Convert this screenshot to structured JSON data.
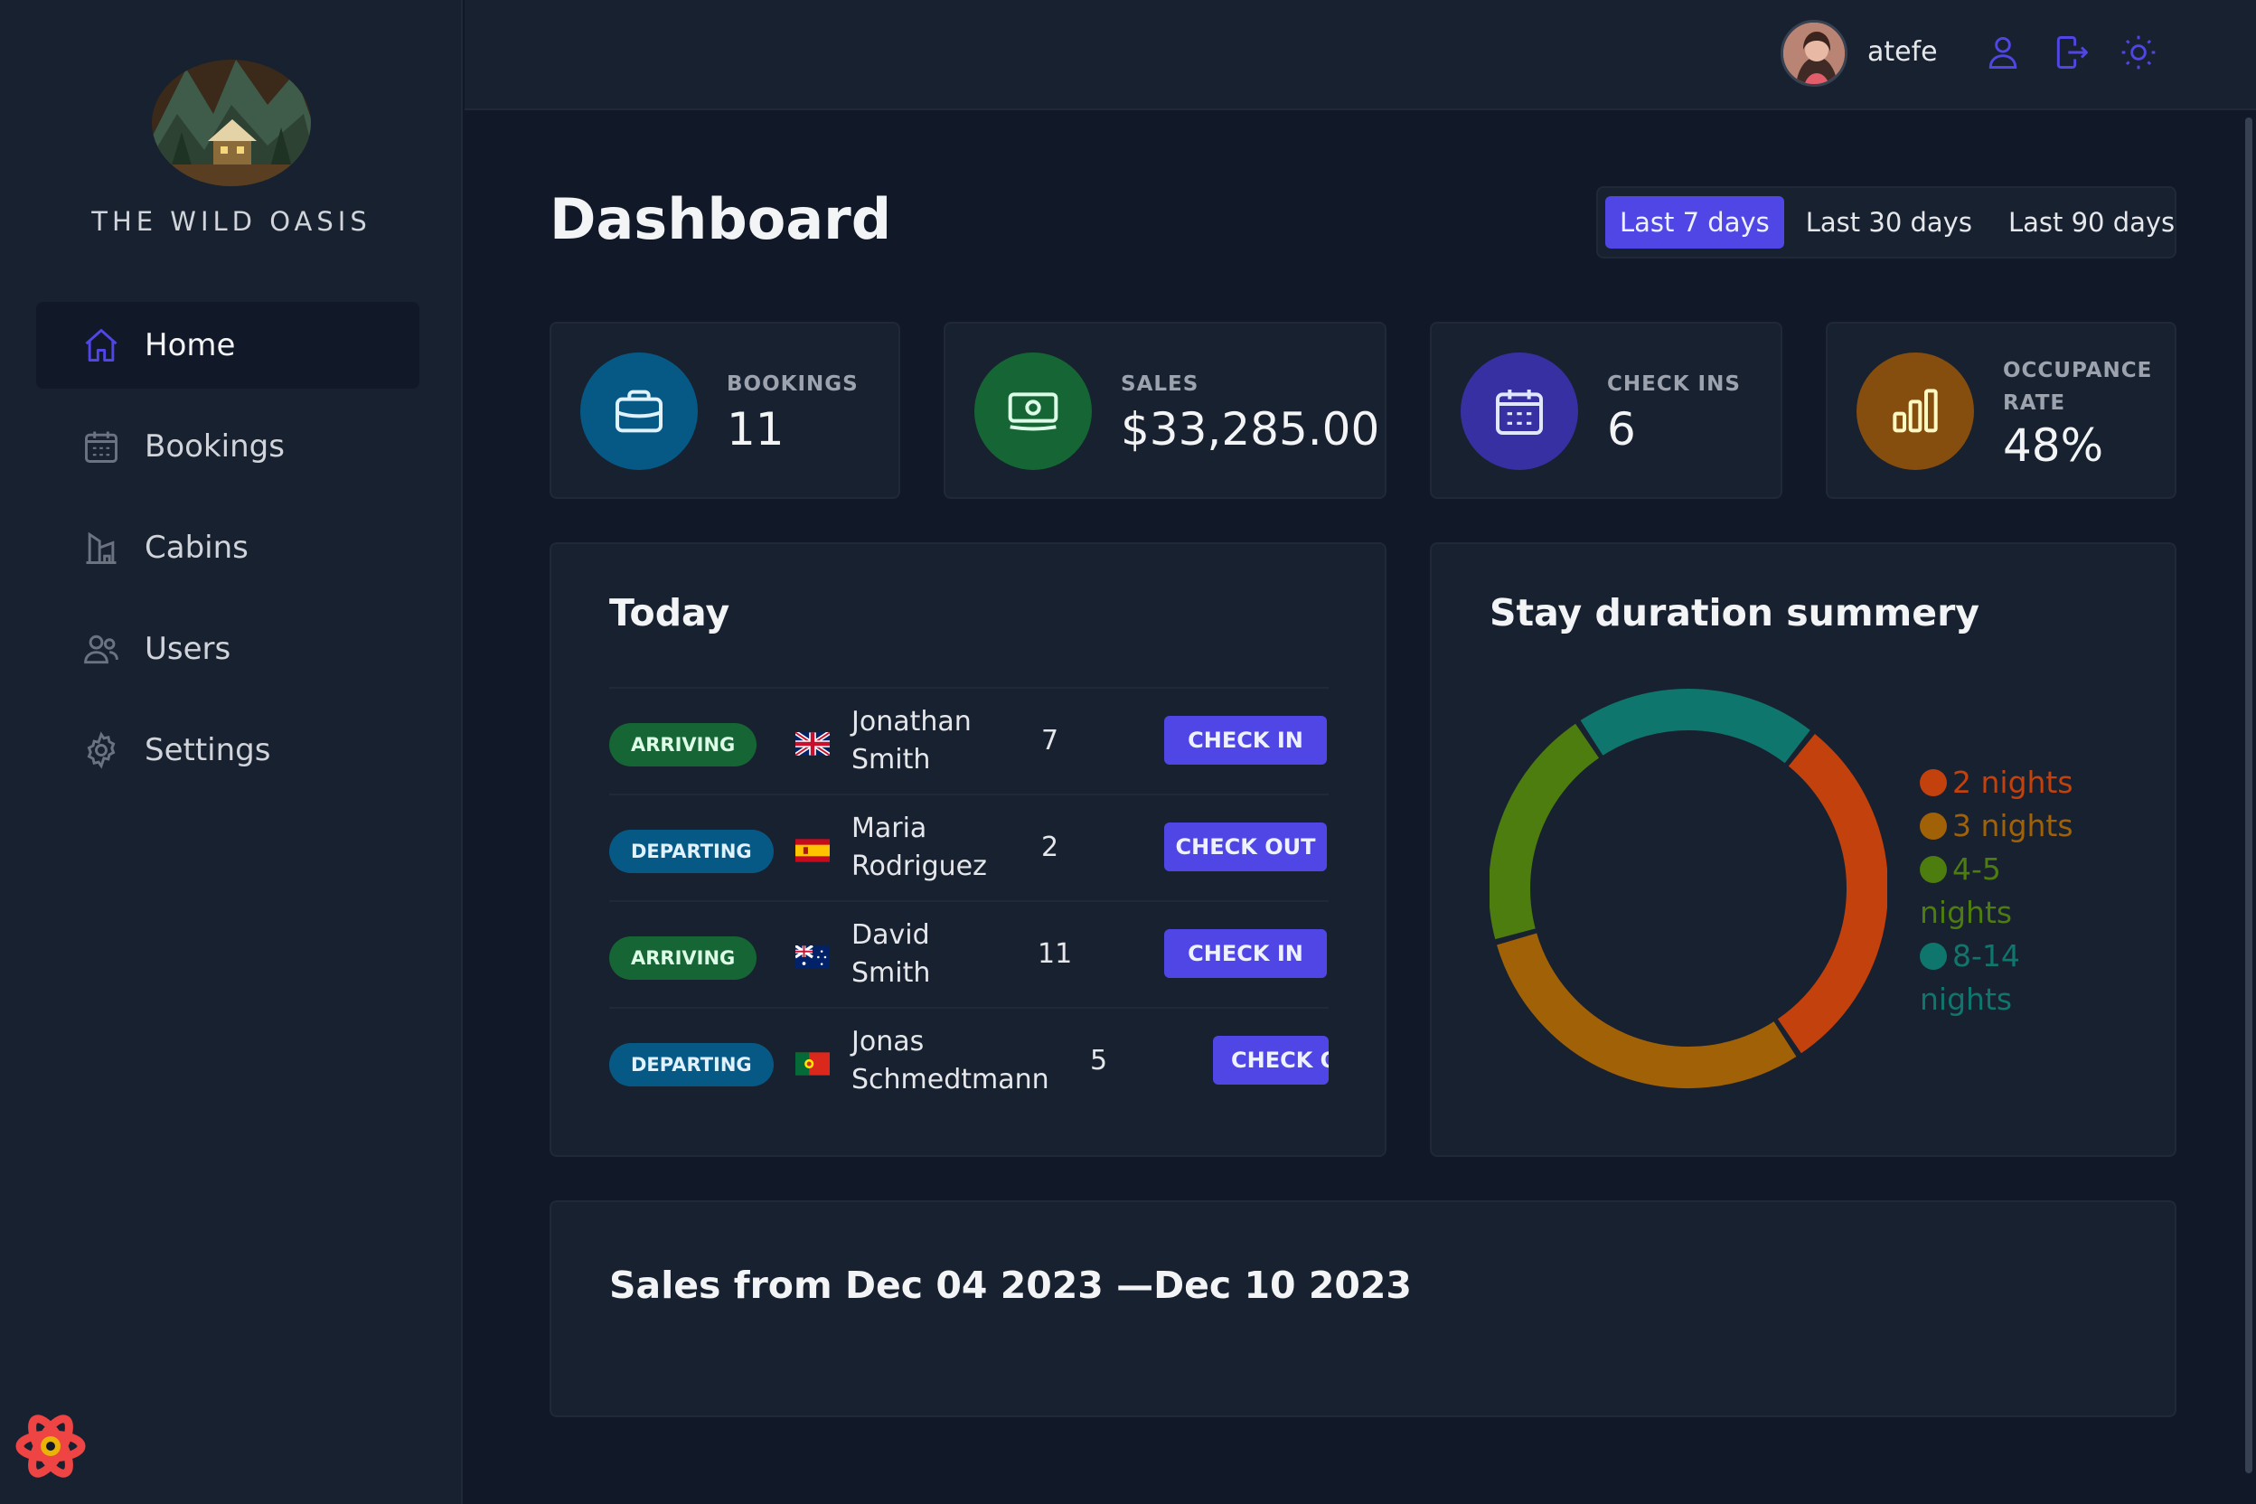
{
  "brand": {
    "name": "THE WILD OASIS"
  },
  "sidebar": {
    "items": [
      {
        "label": "Home",
        "icon": "home-icon",
        "active": true
      },
      {
        "label": "Bookings",
        "icon": "calendar-icon",
        "active": false
      },
      {
        "label": "Cabins",
        "icon": "cabin-icon",
        "active": false
      },
      {
        "label": "Users",
        "icon": "users-icon",
        "active": false
      },
      {
        "label": "Settings",
        "icon": "gear-icon",
        "active": false
      }
    ]
  },
  "header": {
    "username": "atefe",
    "icons": [
      "user-icon",
      "logout-icon",
      "sun-icon"
    ],
    "accent": "#4f46e5"
  },
  "dashboard": {
    "title": "Dashboard",
    "filters": [
      {
        "label": "Last 7 days",
        "active": true
      },
      {
        "label": "Last 30 days",
        "active": false
      },
      {
        "label": "Last 90 days",
        "active": false
      }
    ],
    "stats": [
      {
        "label": "Bookings",
        "value": "11",
        "icon": "briefcase-icon",
        "color": "#075985"
      },
      {
        "label": "Sales",
        "value": "$33,285.00",
        "icon": "banknotes-icon",
        "color": "#166534"
      },
      {
        "label": "Check ins",
        "value": "6",
        "icon": "calendar-days-icon",
        "color": "#3730a3"
      },
      {
        "label": "Occupance rate",
        "value": "48%",
        "icon": "chart-bar-icon",
        "color": "#854d0e"
      }
    ]
  },
  "today": {
    "title": "Today",
    "rows": [
      {
        "status": "Arriving",
        "flag": "gb",
        "guest_first": "Jonathan",
        "guest_last": "Smith",
        "nights": "7",
        "action": "Check in"
      },
      {
        "status": "Departing",
        "flag": "es",
        "guest_first": "Maria",
        "guest_last": "Rodriguez",
        "nights": "2",
        "action": "Check out"
      },
      {
        "status": "Arriving",
        "flag": "au",
        "guest_first": "David",
        "guest_last": "Smith",
        "nights": "11",
        "action": "Check in"
      },
      {
        "status": "Departing",
        "flag": "pt",
        "guest_first": "Jonas",
        "guest_last": "Schmedtmann",
        "nights": "5",
        "action": "Check o"
      }
    ]
  },
  "stay_duration": {
    "title": "Stay duration summery",
    "legend": [
      {
        "label": "2 nights",
        "color": "#c2410c"
      },
      {
        "label": "3 nights",
        "color": "#a16207"
      },
      {
        "label": "4-5 nights",
        "color": "#4d7c0f"
      },
      {
        "label": "8-14 nights",
        "color": "#0f766e"
      }
    ]
  },
  "chart_data": {
    "type": "pie",
    "title": "Stay duration summery",
    "categories": [
      "2 nights",
      "3 nights",
      "4-5 nights",
      "8-14 nights"
    ],
    "values": [
      3,
      3,
      2,
      2
    ],
    "colors": [
      "#c2410c",
      "#a16207",
      "#4d7c0f",
      "#0f766e"
    ],
    "legend": "right"
  },
  "sales": {
    "title": "Sales from Dec 04 2023 —Dec 10 2023"
  }
}
